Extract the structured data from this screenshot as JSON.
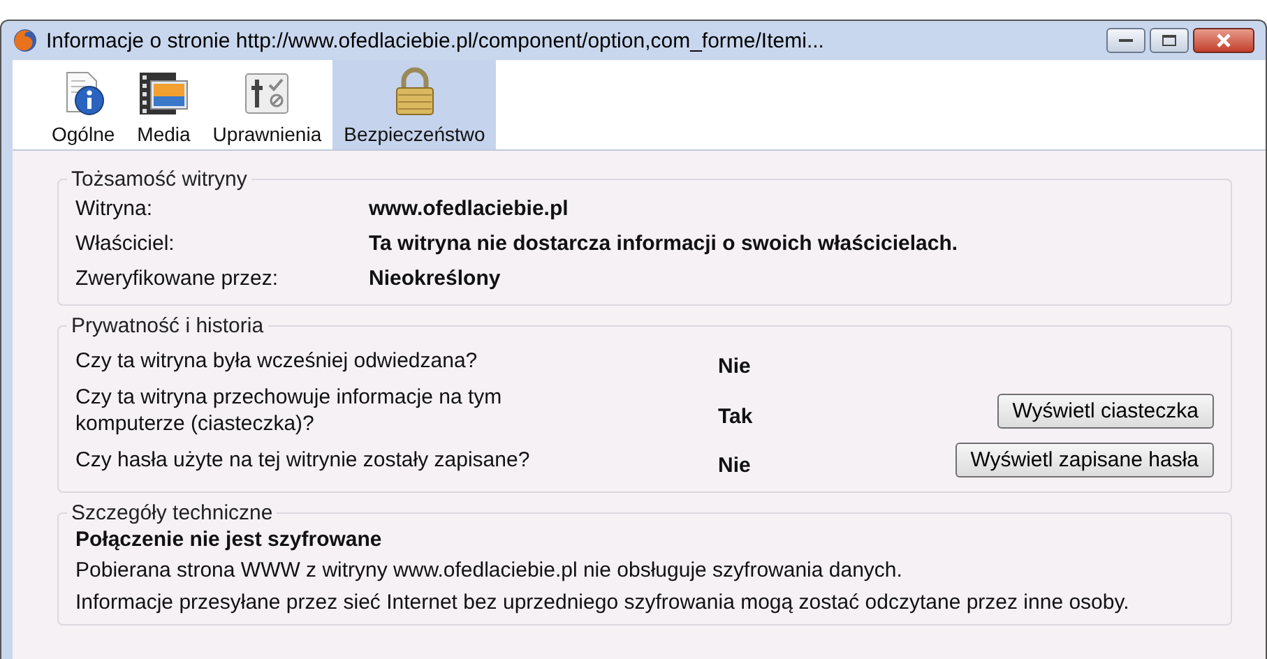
{
  "window": {
    "title": "Informacje o stronie http://www.ofedlaciebie.pl/component/option,com_forme/Itemi..."
  },
  "tabs": [
    {
      "label": "Ogólne",
      "selected": false
    },
    {
      "label": "Media",
      "selected": false
    },
    {
      "label": "Uprawnienia",
      "selected": false
    },
    {
      "label": "Bezpieczeństwo",
      "selected": true
    }
  ],
  "identity": {
    "title": "Tożsamość witryny",
    "rows": [
      {
        "label": "Witryna:",
        "value": "www.ofedlaciebie.pl"
      },
      {
        "label": "Właściciel:",
        "value": "Ta witryna nie dostarcza informacji o swoich właścicielach."
      },
      {
        "label": "Zweryfikowane przez:",
        "value": "Nieokreślony"
      }
    ]
  },
  "privacy": {
    "title": "Prywatność i historia",
    "rows": [
      {
        "question": "Czy ta witryna była wcześniej odwiedzana?",
        "answer": "Nie"
      },
      {
        "question": "Czy ta witryna przechowuje informacje na tym komputerze (ciasteczka)?",
        "answer": "Tak",
        "button": "Wyświetl ciasteczka"
      },
      {
        "question": "Czy hasła użyte na tej witrynie zostały zapisane?",
        "answer": "Nie",
        "button": "Wyświetl zapisane hasła"
      }
    ]
  },
  "technical": {
    "title": "Szczegóły techniczne",
    "heading": "Połączenie nie jest szyfrowane",
    "lines": [
      "Pobierana strona WWW z witryny www.ofedlaciebie.pl nie obsługuje szyfrowania danych.",
      "Informacje przesyłane przez sieć Internet bez uprzedniego szyfrowania mogą zostać odczytane przez inne osoby."
    ]
  }
}
